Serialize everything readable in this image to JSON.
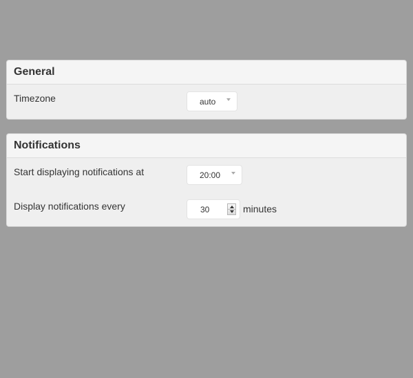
{
  "general": {
    "title": "General",
    "timezone": {
      "label": "Timezone",
      "value": "auto"
    }
  },
  "notifications": {
    "title": "Notifications",
    "start_time": {
      "label": "Start displaying notifications at",
      "value": "20:00"
    },
    "interval": {
      "label": "Display notifications every",
      "value": "30",
      "unit": "minutes"
    }
  },
  "icons": {
    "select_arrow": "chevron-down-icon",
    "stepper_up": "arrow-up-icon",
    "stepper_down": "arrow-down-icon"
  },
  "colors": {
    "background": "#9e9e9e",
    "panel": "#efefef",
    "panel_header": "#f5f5f5"
  }
}
